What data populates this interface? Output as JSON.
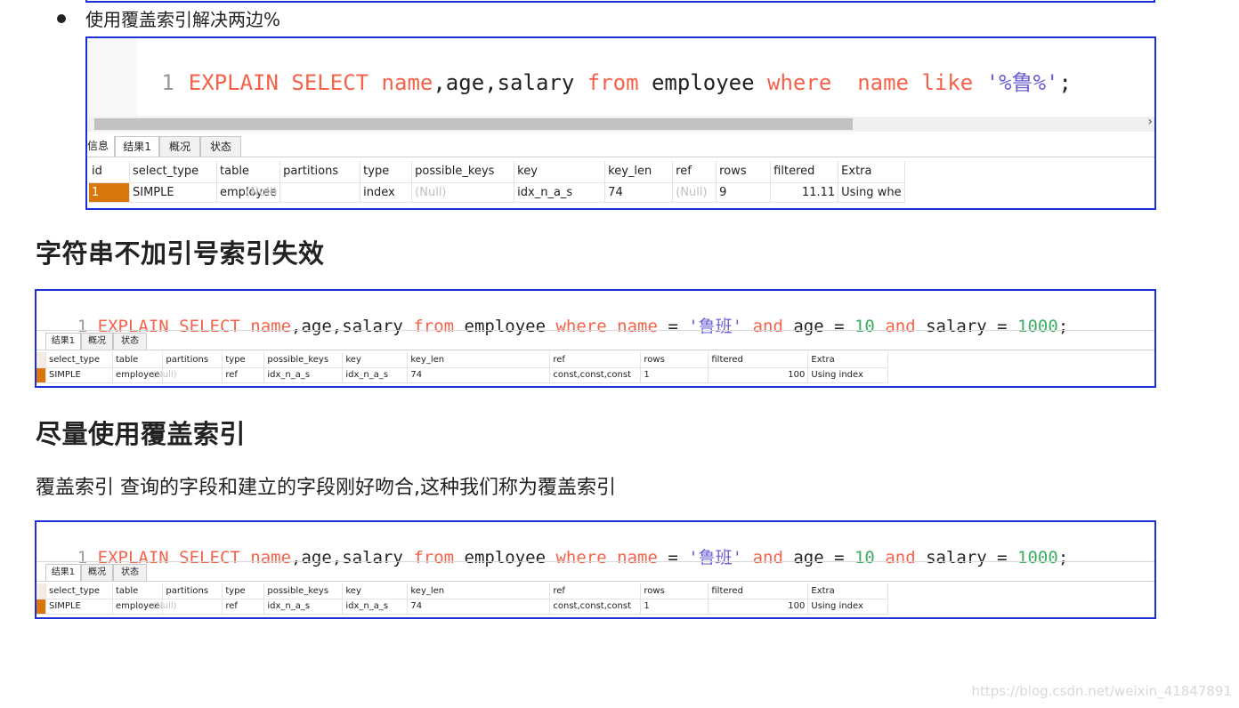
{
  "bullet": {
    "text": "使用覆盖索引解决两边%"
  },
  "shot1": {
    "line_no": "1",
    "tokens": [
      "EXPLAIN SELECT",
      "name",
      ",age,salary ",
      "from",
      " employee ",
      "where",
      "  ",
      "name",
      " ",
      "like",
      " ",
      "'%鲁%'",
      ";"
    ],
    "tabs": [
      "信息",
      "结果1",
      "概况",
      "状态"
    ],
    "active_tab": 1,
    "columns": [
      "id",
      "select_type",
      "table",
      "partitions",
      "type",
      "possible_keys",
      "key",
      "key_len",
      "ref",
      "rows",
      "filtered",
      "Extra"
    ],
    "row": [
      "1",
      "SIMPLE",
      "employee",
      "(Null)",
      "index",
      "(Null)",
      "idx_n_a_s",
      "74",
      "(Null)",
      "9",
      "11.11",
      "Using whe"
    ]
  },
  "section1": {
    "title": "字符串不加引号索引失效"
  },
  "shot2": {
    "line_no": "1",
    "tokens": [
      "EXPLAIN SELECT",
      "name",
      ",age,salary ",
      "from",
      " employee ",
      "where",
      " ",
      "name",
      " = ",
      "'鲁班'",
      " ",
      "and",
      " age = ",
      "10",
      " ",
      "and",
      " salary = ",
      "1000",
      ";"
    ],
    "tabs": [
      "结果1",
      "概况",
      "状态"
    ],
    "active_tab": 0,
    "columns": [
      "select_type",
      "table",
      "partitions",
      "type",
      "possible_keys",
      "key",
      "key_len",
      "ref",
      "rows",
      "filtered",
      "Extra"
    ],
    "row": [
      "SIMPLE",
      "employee",
      "(Null)",
      "ref",
      "idx_n_a_s",
      "idx_n_a_s",
      "74",
      "const,const,const",
      "1",
      "100",
      "Using index"
    ]
  },
  "section2": {
    "title": "尽量使用覆盖索引"
  },
  "paragraph": {
    "text": "覆盖索引 查询的字段和建立的字段刚好吻合,这种我们称为覆盖索引"
  },
  "shot3": {
    "line_no": "1",
    "tokens": [
      "EXPLAIN SELECT",
      "name",
      ",age,salary ",
      "from",
      " employee ",
      "where",
      " ",
      "name",
      " = ",
      "'鲁班'",
      " ",
      "and",
      " age = ",
      "10",
      " ",
      "and",
      " salary = ",
      "1000",
      ";"
    ],
    "tabs": [
      "结果1",
      "概况",
      "状态"
    ],
    "active_tab": 0,
    "columns": [
      "select_type",
      "table",
      "partitions",
      "type",
      "possible_keys",
      "key",
      "key_len",
      "ref",
      "rows",
      "filtered",
      "Extra"
    ],
    "row": [
      "SIMPLE",
      "employee",
      "(Null)",
      "ref",
      "idx_n_a_s",
      "idx_n_a_s",
      "74",
      "const,const,const",
      "1",
      "100",
      "Using index"
    ]
  },
  "watermark": {
    "text": "https://blog.csdn.net/weixin_41847891"
  },
  "colors": {
    "frame": "#1d2fd6",
    "keyword": "#f4624a",
    "string": "#6a5fd6",
    "number": "#3aaf61",
    "selected_row_marker": "#d9770d"
  }
}
